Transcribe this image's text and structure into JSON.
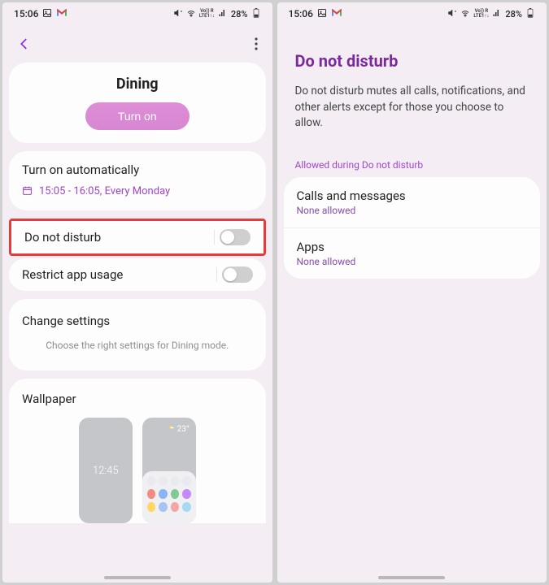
{
  "status": {
    "time": "15:06",
    "battery": "28%"
  },
  "screen1": {
    "title": "Dining",
    "turn_on": "Turn on",
    "auto_title": "Turn on automatically",
    "schedule": "15:05 - 16:05, Every Monday",
    "dnd_label": "Do not disturb",
    "restrict_label": "Restrict app usage",
    "change_title": "Change settings",
    "change_sub": "Choose the right settings for Dining mode.",
    "wallpaper_title": "Wallpaper",
    "lock_time": "12:45",
    "home_temp": "23°"
  },
  "screen2": {
    "title": "Do not disturb",
    "desc": "Do not disturb mutes all calls, notifications, and other alerts except for those you choose to allow.",
    "section_label": "Allowed during Do not disturb",
    "calls_title": "Calls and messages",
    "calls_sub": "None allowed",
    "apps_title": "Apps",
    "apps_sub": "None allowed"
  }
}
